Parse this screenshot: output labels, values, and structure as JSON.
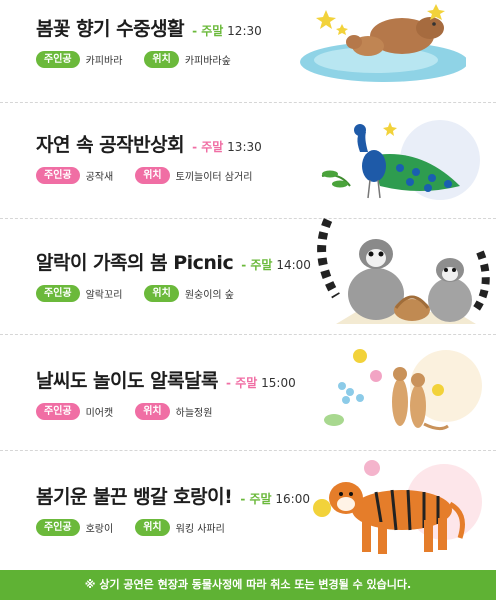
{
  "colors": {
    "green": "#6bb93b",
    "pink": "#f06ea4",
    "footer": "#5fb234"
  },
  "shows": [
    {
      "title": "봄꽃 향기 수중생활",
      "tag": "주말",
      "time": "12:30",
      "tag_color": "#6bb93b",
      "lead_label": "주인공",
      "lead": "카피바라",
      "place_label": "위치",
      "place": "카피바라숲",
      "lead_pill_color": "#6bb93b",
      "place_pill_color": "#6bb93b",
      "illustration": "capybara"
    },
    {
      "title": "자연 속 공작반상회",
      "tag": "주말",
      "time": "13:30",
      "tag_color": "#f06ea4",
      "lead_label": "주인공",
      "lead": "공작새",
      "place_label": "위치",
      "place": "토끼늘이터 삼거리",
      "lead_pill_color": "#f06ea4",
      "place_pill_color": "#f06ea4",
      "illustration": "peacock"
    },
    {
      "title": "알락이 가족의 봄 Picnic",
      "tag": "주말",
      "time": "14:00",
      "tag_color": "#6bb93b",
      "lead_label": "주인공",
      "lead": "알락꼬리",
      "place_label": "위치",
      "place": "원숭이의 숲",
      "lead_pill_color": "#6bb93b",
      "place_pill_color": "#6bb93b",
      "illustration": "lemur"
    },
    {
      "title": "날씨도 놀이도 알록달록",
      "tag": "주말",
      "time": "15:00",
      "tag_color": "#f06ea4",
      "lead_label": "주인공",
      "lead": "미어캣",
      "place_label": "위치",
      "place": "하늘정원",
      "lead_pill_color": "#f06ea4",
      "place_pill_color": "#f06ea4",
      "illustration": "meerkat"
    },
    {
      "title": "봄기운 불끈 뱅갈 호랑이!",
      "tag": "주말",
      "time": "16:00",
      "tag_color": "#6bb93b",
      "lead_label": "주인공",
      "lead": "호랑이",
      "place_label": "위치",
      "place": "워킹 사파리",
      "lead_pill_color": "#6bb93b",
      "place_pill_color": "#6bb93b",
      "illustration": "tiger"
    }
  ],
  "footer": "※ 상기 공연은 현장과 동물사정에 따라 취소 또는 변경될 수 있습니다."
}
